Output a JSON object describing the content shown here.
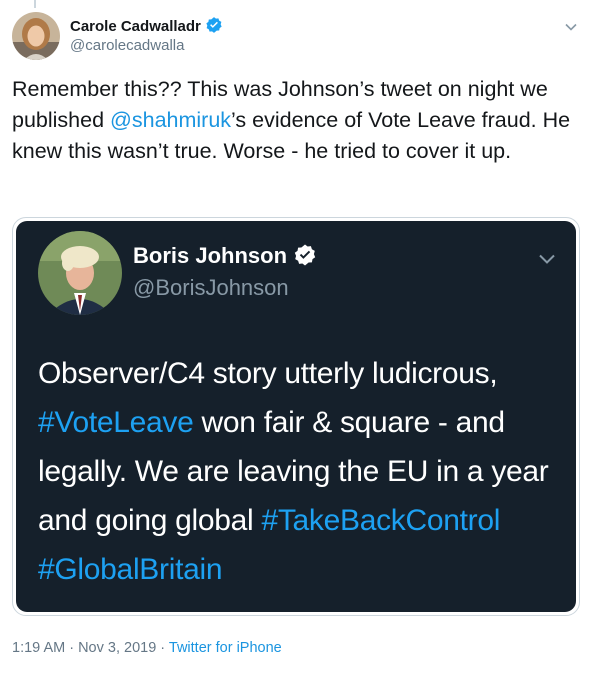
{
  "tweet": {
    "author_name": "Carole Cadwalladr",
    "author_handle": "@carolecadwalla",
    "text_1": "Remember this?? This was Johnson’s tweet on night we published ",
    "mention": "@shahmiruk",
    "text_2": "’s evidence of Vote Leave fraud. He knew this wasn’t true. Worse - he tried to cover it up.",
    "timestamp": "1:19 AM · Nov 3, 2019 · ",
    "source": "Twitter for iPhone",
    "icons": {
      "verified": "verified-badge-icon",
      "menu": "chevron-down-icon"
    }
  },
  "quoted": {
    "author_name": "Boris Johnson",
    "author_handle": "@BorisJohnson",
    "text_1": "Observer/C4 story utterly ludicrous, ",
    "hashtag_1": "#VoteLeave",
    "text_2": " won fair & square - and legally. We are leaving the EU in a year and going global ",
    "hashtag_2": "#TakeBackControl",
    "text_3": " ",
    "hashtag_3": "#GlobalBritain"
  },
  "colors": {
    "link": "#1b95e0",
    "quote_bg": "#15202b",
    "secondary": "#657786",
    "verified": "#1da1f2"
  }
}
